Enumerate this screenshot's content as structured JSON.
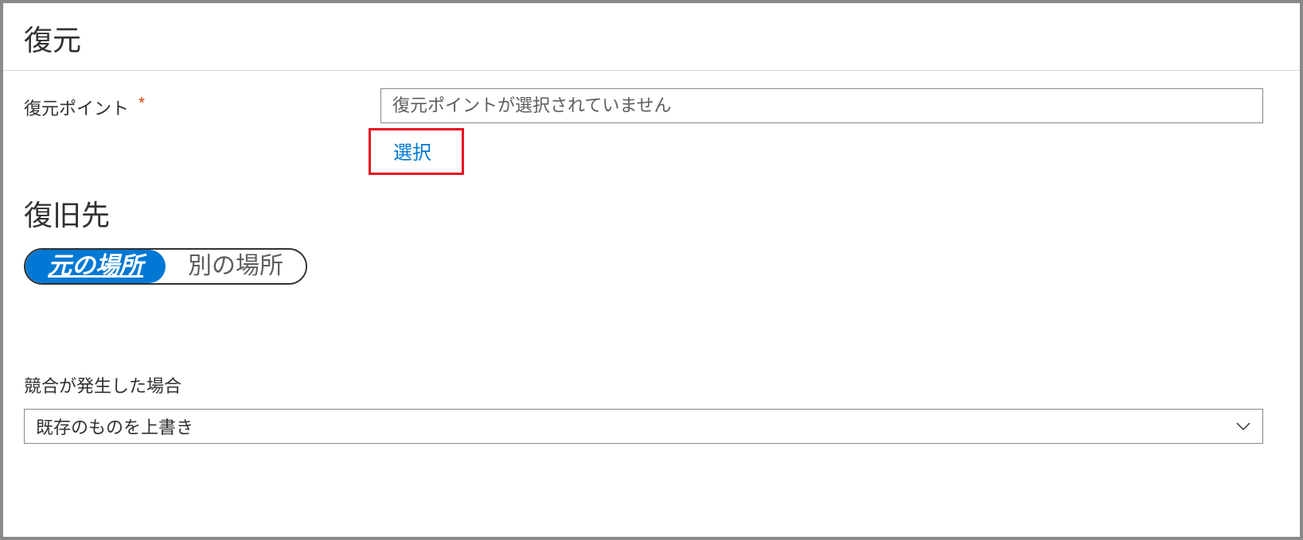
{
  "header": {
    "title": "復元"
  },
  "restorePoint": {
    "label": "復元ポイント",
    "required": "*",
    "placeholder": "復元ポイントが選択されていません",
    "selectLink": "選択"
  },
  "destination": {
    "heading": "復旧先",
    "options": {
      "original": "元の場所",
      "alternate": "別の場所"
    }
  },
  "conflict": {
    "label": "競合が発生した場合",
    "selected": "既存のものを上書き"
  }
}
